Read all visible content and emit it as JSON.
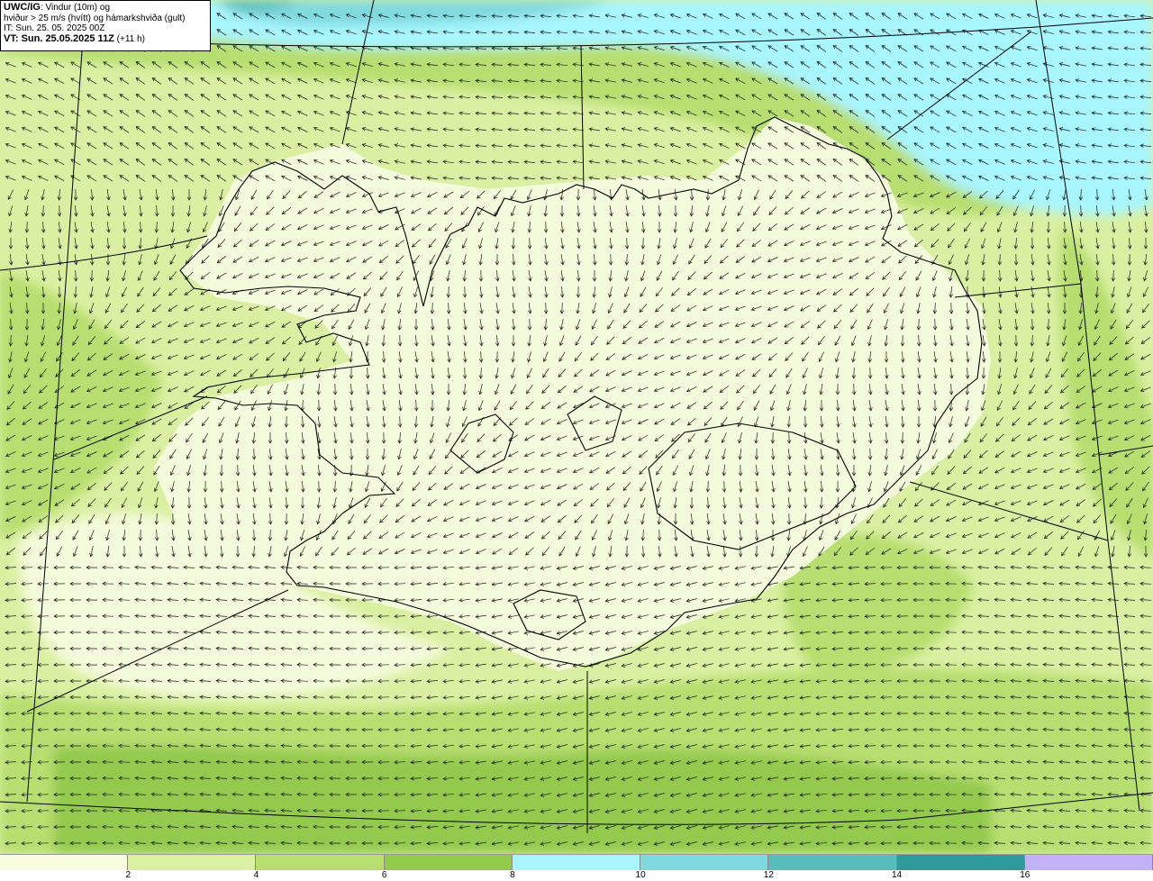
{
  "header": {
    "model": "UWC/IG",
    "title_rest": ": Vindur (10m) og",
    "line2": "hviður > 25 m/s (hvítt) og hámarkshviða (gult)",
    "line3": "IT: Sun. 25. 05. 2025 00Z",
    "line4_bold": "VT: Sun. 25.05.2025 11Z",
    "line4_rest": " (+11 h)"
  },
  "legend": {
    "tick_labels": [
      "2",
      "4",
      "6",
      "8",
      "10",
      "12",
      "14",
      "16"
    ],
    "colors": [
      "#f8fde0",
      "#dcf0a4",
      "#b7de6f",
      "#93c94d",
      "#a8f6ff",
      "#7fd9de",
      "#56bcbc",
      "#2e9a9a",
      "#c3b2f5"
    ]
  },
  "map": {
    "colors": {
      "land_base": "#f4fbdc",
      "sea_light": "#d9f0a2",
      "sea_mid": "#b7de6f",
      "sea_dark": "#93c94d",
      "cyan": "#a8f6ff",
      "cyan_mid": "#7fd9de",
      "teal": "#56bcbc",
      "arrow": "#1a1a1a",
      "coast": "#000000"
    }
  }
}
